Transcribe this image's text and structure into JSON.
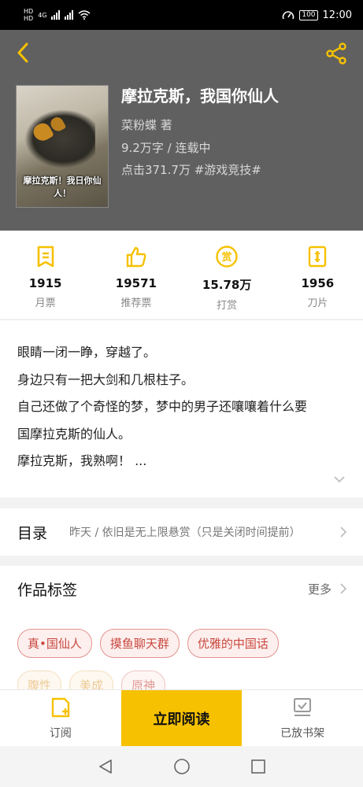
{
  "status_bar": {
    "net_1": "HD",
    "net_2": "HD",
    "gen": "4G",
    "battery": "100",
    "time": "12:00"
  },
  "header": {
    "book_title": "摩拉克斯，我国你仙人",
    "author": "菜粉蝶  著",
    "words": "9.2万字 / 连载中",
    "clicks": "点击371.7万 #游戏竞技#",
    "cover_text": "摩拉克斯！我日你仙人！"
  },
  "stats": [
    {
      "value": "1915",
      "label": "月票",
      "icon": "monthly-ticket-icon"
    },
    {
      "value": "19571",
      "label": "推荐票",
      "icon": "thumbs-up-icon"
    },
    {
      "value": "15.78万",
      "label": "打赏",
      "icon": "reward-coin-icon"
    },
    {
      "value": "1956",
      "label": "刀片",
      "icon": "blade-icon"
    }
  ],
  "intro": {
    "lines": [
      "眼睛一闭一睁，穿越了。",
      "身边只有一把大剑和几根柱子。",
      "自己还做了个奇怪的梦，梦中的男子还嚷嚷着什么要",
      "国摩拉克斯的仙人。",
      "摩拉克斯，我熟啊！ ..."
    ]
  },
  "toc": {
    "title": "目录",
    "latest": "昨天 / 依旧是无上限悬赏（只是关闭时间提前）"
  },
  "tags": {
    "title": "作品标签",
    "more": "更多",
    "row1": [
      "真•国仙人",
      "摸鱼聊天群",
      "优雅的中国话"
    ],
    "row2": [
      "腹性",
      "美成",
      "原神"
    ]
  },
  "bottom_bar": {
    "subscribe": "订阅",
    "read_now": "立即阅读",
    "shelf": "已放书架"
  },
  "colors": {
    "accent": "#f6c100",
    "header_bg": "#606060",
    "tag_red": "#c9483f"
  }
}
